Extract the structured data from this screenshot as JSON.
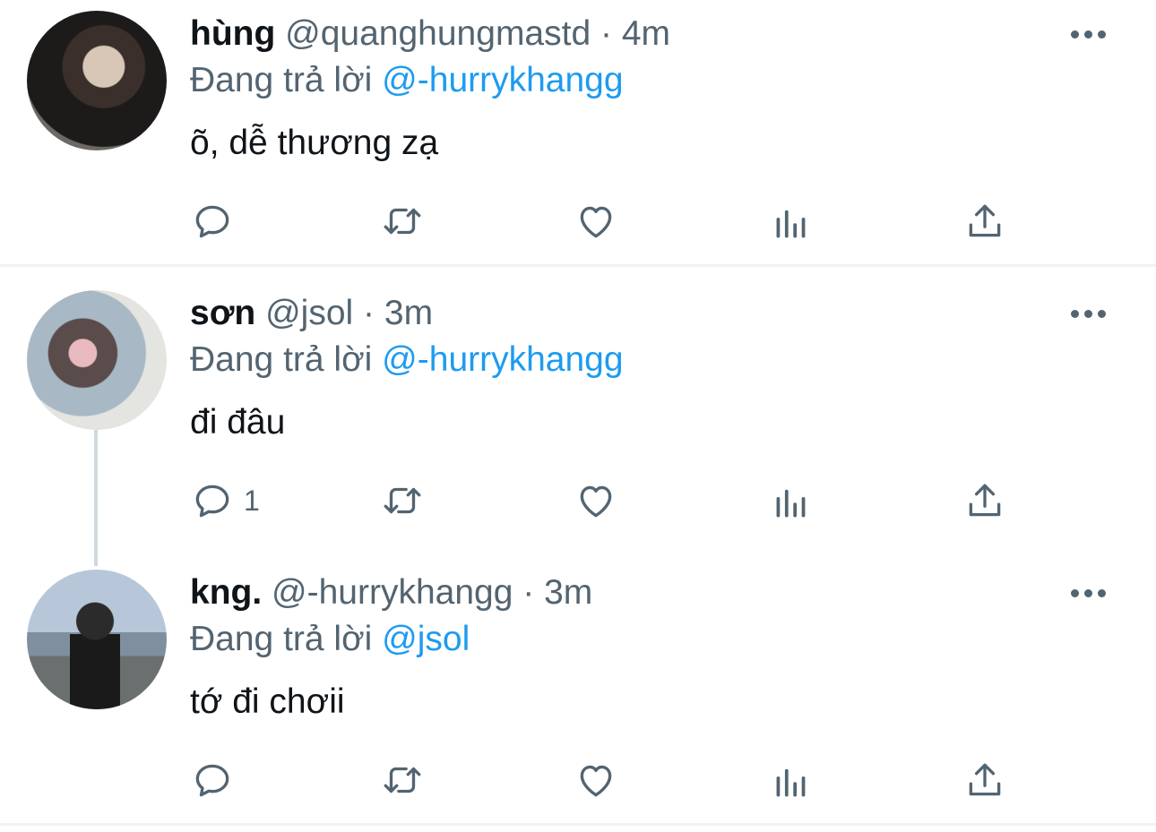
{
  "tweets": [
    {
      "name": "hùng",
      "handle": "@quanghungmastd",
      "separator": "·",
      "time": "4m",
      "replying_prefix": "Đang trả lời",
      "replying_to": "@-hurrykhangg",
      "text": "õ, dễ thương zạ",
      "reply_count": ""
    },
    {
      "name": "sơn",
      "handle": "@jsol",
      "separator": "·",
      "time": "3m",
      "replying_prefix": "Đang trả lời",
      "replying_to": "@-hurrykhangg",
      "text": "đi đâu",
      "reply_count": "1"
    },
    {
      "name": "kng.",
      "handle": "@-hurrykhangg",
      "separator": "·",
      "time": "3m",
      "replying_prefix": "Đang trả lời",
      "replying_to": "@jsol",
      "text": "tớ đi chơii",
      "reply_count": ""
    }
  ],
  "icons": {
    "reply": "reply-icon",
    "retweet": "retweet-icon",
    "like": "heart-icon",
    "stats": "analytics-icon",
    "share": "share-icon",
    "more": "more-icon"
  },
  "colors": {
    "mention": "#1d9bf0",
    "secondary": "#536471",
    "text": "#0f1419",
    "divider": "#eff3f4",
    "thread_line": "#cfd9de"
  }
}
